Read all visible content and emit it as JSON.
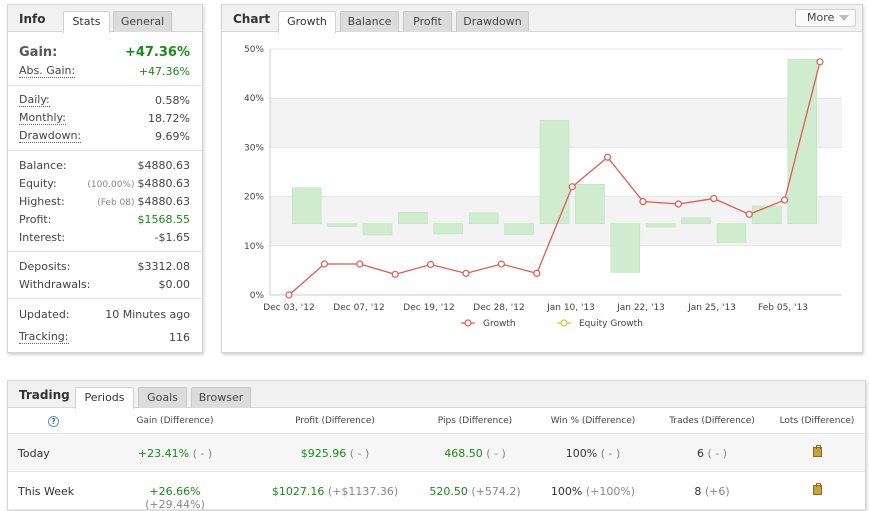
{
  "info": {
    "title": "Info",
    "tabs": [
      "Stats",
      "General"
    ],
    "gain_label": "Gain:",
    "gain_value": "+47.36%",
    "abs_gain_label": "Abs. Gain:",
    "abs_gain_value": "+47.36%",
    "daily_label": "Daily:",
    "daily_value": "0.58%",
    "monthly_label": "Monthly:",
    "monthly_value": "18.72%",
    "drawdown_label": "Drawdown:",
    "drawdown_value": "9.69%",
    "balance_label": "Balance:",
    "balance_value": "$4880.63",
    "equity_label": "Equity:",
    "equity_sub": "(100.00%)",
    "equity_value": "$4880.63",
    "highest_label": "Highest:",
    "highest_sub": "(Feb 08)",
    "highest_value": "$4880.63",
    "profit_label": "Profit:",
    "profit_value": "$1568.55",
    "interest_label": "Interest:",
    "interest_value": "-$1.65",
    "deposits_label": "Deposits:",
    "deposits_value": "$3312.08",
    "withdrawals_label": "Withdrawals:",
    "withdrawals_value": "$0.00",
    "updated_label": "Updated:",
    "updated_value": "10 Minutes ago",
    "tracking_label": "Tracking:",
    "tracking_value": "116"
  },
  "chart": {
    "title": "Chart",
    "tabs": [
      "Growth",
      "Balance",
      "Profit",
      "Drawdown"
    ],
    "more_label": "More"
  },
  "chart_data": {
    "type": "line",
    "ylim": [
      0,
      50
    ],
    "yticks": [
      "0%",
      "10%",
      "20%",
      "30%",
      "40%",
      "50%"
    ],
    "xlabels": [
      "Dec 03, '12",
      "Dec 07, '12",
      "Dec 19, '12",
      "Dec 28, '12",
      "Jan 10, '13",
      "Jan 22, '13",
      "Jan 25, '13",
      "Feb 05, '13"
    ],
    "growth": [
      0,
      6.3,
      6.3,
      4.2,
      6.2,
      4.4,
      6.3,
      4.4,
      22,
      28,
      19,
      18.5,
      19.6,
      16.4,
      19.3,
      47.4
    ],
    "bars": [
      {
        "from": 14.5,
        "to": 21.8
      },
      {
        "from": 14.5,
        "to": 14.5
      },
      {
        "from": 14.5,
        "to": 12.2
      },
      {
        "from": 14.5,
        "to": 16.8
      },
      {
        "from": 14.5,
        "to": 12.4
      },
      {
        "from": 14.5,
        "to": 16.7
      },
      {
        "from": 14.5,
        "to": 12.3
      },
      {
        "from": 14.5,
        "to": 35.5
      },
      {
        "from": 14.5,
        "to": 22.5
      },
      {
        "from": 14.5,
        "to": 4.6
      },
      {
        "from": 14.5,
        "to": 13.8
      },
      {
        "from": 14.5,
        "to": 15.7
      },
      {
        "from": 14.5,
        "to": 10.7
      },
      {
        "from": 14.5,
        "to": 18.1
      },
      {
        "from": 14.5,
        "to": 47.9
      }
    ],
    "legend": [
      "Growth",
      "Equity Growth"
    ],
    "colors": {
      "growth": "#e05a4e",
      "equity": "#e8b830",
      "bar": "#cfeccf",
      "bar_stroke": "#b7dfb7"
    }
  },
  "trading": {
    "title": "Trading",
    "tabs": [
      "Periods",
      "Goals",
      "Browser"
    ],
    "columns": [
      "Gain (Difference)",
      "Profit (Difference)",
      "Pips (Difference)",
      "Win % (Difference)",
      "Trades (Difference)",
      "Lots (Difference)"
    ],
    "rows": [
      {
        "label": "Today",
        "gain": "+23.41%",
        "gain_diff": "( - )",
        "profit": "$925.96",
        "profit_diff": "( - )",
        "pips": "468.50",
        "pips_diff": "( - )",
        "win": "100%",
        "win_diff": "( - )",
        "trades": "6",
        "trades_diff": "( - )"
      },
      {
        "label": "This Week",
        "gain": "+26.66%",
        "gain_diff": "(+29.44%)",
        "profit": "$1027.16",
        "profit_diff": "(+$1137.36)",
        "pips": "520.50",
        "pips_diff": "(+574.2)",
        "win": "100%",
        "win_diff": "(+100%)",
        "trades": "8",
        "trades_diff": "(+6)"
      }
    ]
  }
}
